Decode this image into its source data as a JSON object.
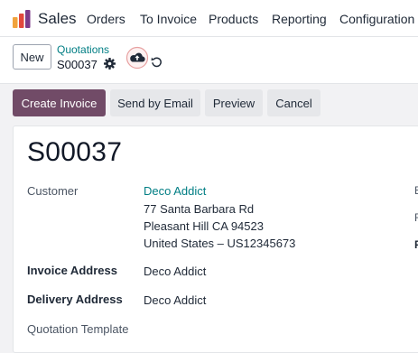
{
  "navbar": {
    "app_name": "Sales",
    "menu": [
      "Orders",
      "To Invoice",
      "Products",
      "Reporting",
      "Configuration"
    ]
  },
  "control": {
    "new_label": "New",
    "breadcrumb": "Quotations",
    "record_name": "S00037"
  },
  "actions": {
    "create_invoice": "Create Invoice",
    "send_email": "Send by Email",
    "preview": "Preview",
    "cancel": "Cancel"
  },
  "form": {
    "title": "S00037",
    "customer_label": "Customer",
    "customer_name": "Deco Addict",
    "address_line1": "77 Santa Barbara Rd",
    "address_line2": "Pleasant Hill CA 94523",
    "address_line3": "United States – US12345673",
    "invoice_address_label": "Invoice Address",
    "invoice_address": "Deco Addict",
    "delivery_address_label": "Delivery Address",
    "delivery_address": "Deco Addict",
    "quotation_template_label": "Quotation Template",
    "right_edge_labels": [
      "E",
      "F",
      "F"
    ]
  },
  "colors": {
    "primary": "#714b67",
    "link": "#017e84",
    "app_icon": [
      "#f1a33c",
      "#e2483d",
      "#7c3a8a"
    ]
  },
  "icons": {
    "gear": "gear-icon",
    "save": "cloud-upload-icon",
    "discard": "undo-icon"
  }
}
